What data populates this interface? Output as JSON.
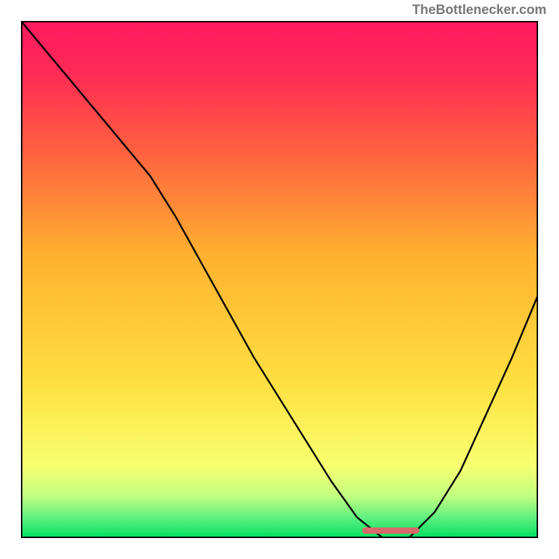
{
  "watermark": "TheBottlenecker.com",
  "chart_data": {
    "type": "line",
    "title": "",
    "xlabel": "",
    "ylabel": "",
    "xlim": [
      0,
      100
    ],
    "ylim": [
      0,
      100
    ],
    "grid": false,
    "series": [
      {
        "name": "curve",
        "x": [
          0,
          5,
          10,
          15,
          20,
          25,
          30,
          35,
          40,
          45,
          50,
          55,
          60,
          65,
          70,
          75,
          80,
          85,
          90,
          95,
          100
        ],
        "values": [
          100,
          94,
          88,
          82,
          76,
          70,
          62,
          53,
          44,
          35,
          27,
          19,
          11,
          4,
          0,
          0,
          5,
          13,
          24,
          35,
          47
        ]
      }
    ],
    "optimum_bar": {
      "x_start": 66,
      "x_end": 77,
      "y": 1.5
    },
    "gradient_bands": [
      {
        "y": 0,
        "color": "#00e060"
      },
      {
        "y": 4,
        "color": "#60f080"
      },
      {
        "y": 8,
        "color": "#c0ff80"
      },
      {
        "y": 14,
        "color": "#f8ff70"
      },
      {
        "y": 30,
        "color": "#ffe040"
      },
      {
        "y": 55,
        "color": "#ffb030"
      },
      {
        "y": 75,
        "color": "#ff6040"
      },
      {
        "y": 90,
        "color": "#ff2a55"
      },
      {
        "y": 100,
        "color": "#ff1a60"
      }
    ]
  }
}
